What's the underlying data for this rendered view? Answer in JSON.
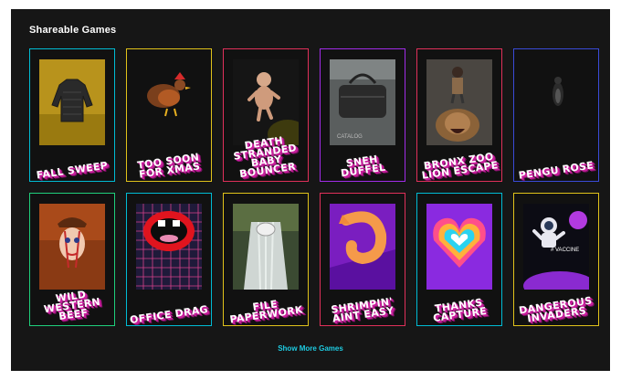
{
  "section": {
    "title": "Shareable Games"
  },
  "games": [
    {
      "name": "Fall Sweep",
      "border": "#00bcd4"
    },
    {
      "name": "Too Soon For Xmas",
      "border": "#e0c21a"
    },
    {
      "name": "Death Stranded Baby Bouncer",
      "border": "#e0305a"
    },
    {
      "name": "Sneh Duffel",
      "border": "#a12ce8"
    },
    {
      "name": "Bronx Zoo Lion Escape",
      "border": "#e0305a"
    },
    {
      "name": "Pengu Rose",
      "border": "#3a4bd8"
    },
    {
      "name": "Wild Western Beef",
      "border": "#1fcf7c"
    },
    {
      "name": "Office Drag",
      "border": "#00bcd4"
    },
    {
      "name": "File Paperwork",
      "border": "#e0c21a"
    },
    {
      "name": "Shrimpin' Aint Easy",
      "border": "#e0305a"
    },
    {
      "name": "Thanks Capture",
      "border": "#00bcd4"
    },
    {
      "name": "Dangerous Invaders",
      "border": "#e0c21a"
    }
  ],
  "thumb_labels": {
    "duffel": "CATALOG",
    "vaccine": "# VACCINE"
  },
  "footer": {
    "more_label": "Show More Games"
  }
}
